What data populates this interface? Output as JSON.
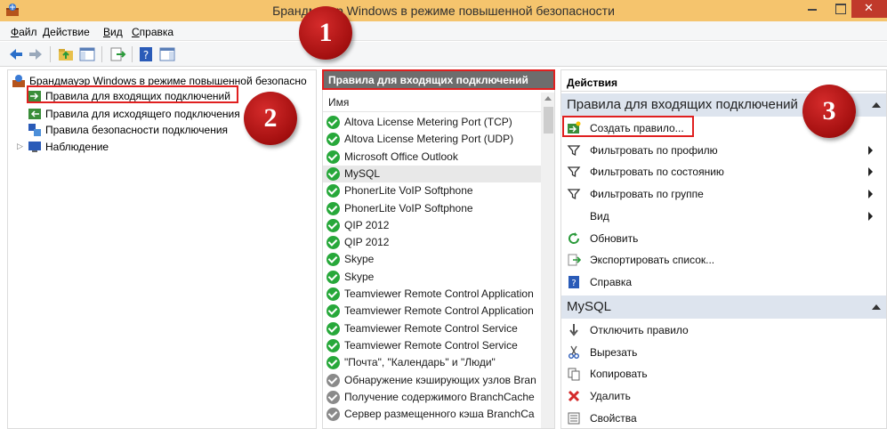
{
  "window": {
    "title": "Брандмауэр Windows в режиме повышенной безопасности",
    "icon": "firewall-icon"
  },
  "menubar": {
    "items": [
      "Файл",
      "Действие",
      "Вид",
      "Справка"
    ]
  },
  "toolbar": {
    "buttons": [
      "back-arrow-icon",
      "forward-arrow-icon",
      "up-folder-icon",
      "show-hide-tree-icon",
      "export-icon",
      "help-icon",
      "show-hide-action-pane-icon"
    ]
  },
  "tree": {
    "root": "Брандмауэр Windows в режиме повышенной безопасно",
    "items": [
      "Правила для входящих подключений",
      "Правила для исходящего подключения",
      "Правила безопасности подключения",
      "Наблюдение"
    ]
  },
  "rules_panel": {
    "header": "Правила для входящих подключений",
    "column_name": "Имя",
    "rules": [
      {
        "name": "Altova License Metering Port (TCP)",
        "status": "enabled"
      },
      {
        "name": "Altova License Metering Port (UDP)",
        "status": "enabled"
      },
      {
        "name": "Microsoft Office Outlook",
        "status": "enabled"
      },
      {
        "name": "MySQL",
        "status": "enabled",
        "selected": true
      },
      {
        "name": "PhonerLite VoIP Softphone",
        "status": "enabled"
      },
      {
        "name": "PhonerLite VoIP Softphone",
        "status": "enabled"
      },
      {
        "name": "QIP 2012",
        "status": "enabled"
      },
      {
        "name": "QIP 2012",
        "status": "enabled"
      },
      {
        "name": "Skype",
        "status": "enabled"
      },
      {
        "name": "Skype",
        "status": "enabled"
      },
      {
        "name": "Teamviewer Remote Control Application",
        "status": "enabled"
      },
      {
        "name": "Teamviewer Remote Control Application",
        "status": "enabled"
      },
      {
        "name": "Teamviewer Remote Control Service",
        "status": "enabled"
      },
      {
        "name": "Teamviewer Remote Control Service",
        "status": "enabled"
      },
      {
        "name": "\"Почта\", \"Календарь\" и \"Люди\"",
        "status": "enabled"
      },
      {
        "name": "Обнаружение кэширующих узлов Bran",
        "status": "disabled"
      },
      {
        "name": "Получение содержимого BranchCache",
        "status": "disabled"
      },
      {
        "name": "Сервер размещенного кэша BranchCa",
        "status": "disabled"
      }
    ]
  },
  "actions_panel": {
    "title": "Действия",
    "section1": {
      "header": "Правила для входящих подключений",
      "items": [
        {
          "label": "Создать правило...",
          "icon": "new-rule-icon"
        },
        {
          "label": "Фильтровать по профилю",
          "icon": "filter-icon",
          "submenu": true
        },
        {
          "label": "Фильтровать по состоянию",
          "icon": "filter-icon",
          "submenu": true
        },
        {
          "label": "Фильтровать по группе",
          "icon": "filter-icon",
          "submenu": true
        },
        {
          "label": "Вид",
          "icon": "",
          "submenu": true
        },
        {
          "label": "Обновить",
          "icon": "refresh-icon"
        },
        {
          "label": "Экспортировать список...",
          "icon": "export-icon"
        },
        {
          "label": "Справка",
          "icon": "help-icon"
        }
      ]
    },
    "section2": {
      "header": "MySQL",
      "items": [
        {
          "label": "Отключить правило",
          "icon": "disable-icon"
        },
        {
          "label": "Вырезать",
          "icon": "cut-icon"
        },
        {
          "label": "Копировать",
          "icon": "copy-icon"
        },
        {
          "label": "Удалить",
          "icon": "delete-icon"
        },
        {
          "label": "Свойства",
          "icon": "properties-icon"
        }
      ]
    }
  },
  "callouts": [
    "1",
    "2",
    "3"
  ],
  "colors": {
    "titlebar": "#f5c46d",
    "highlight": "#e02020",
    "callout": "#b01515",
    "enabled": "#27a83a",
    "disabled": "#8a8a8a",
    "section_header": "#dde4ee"
  }
}
